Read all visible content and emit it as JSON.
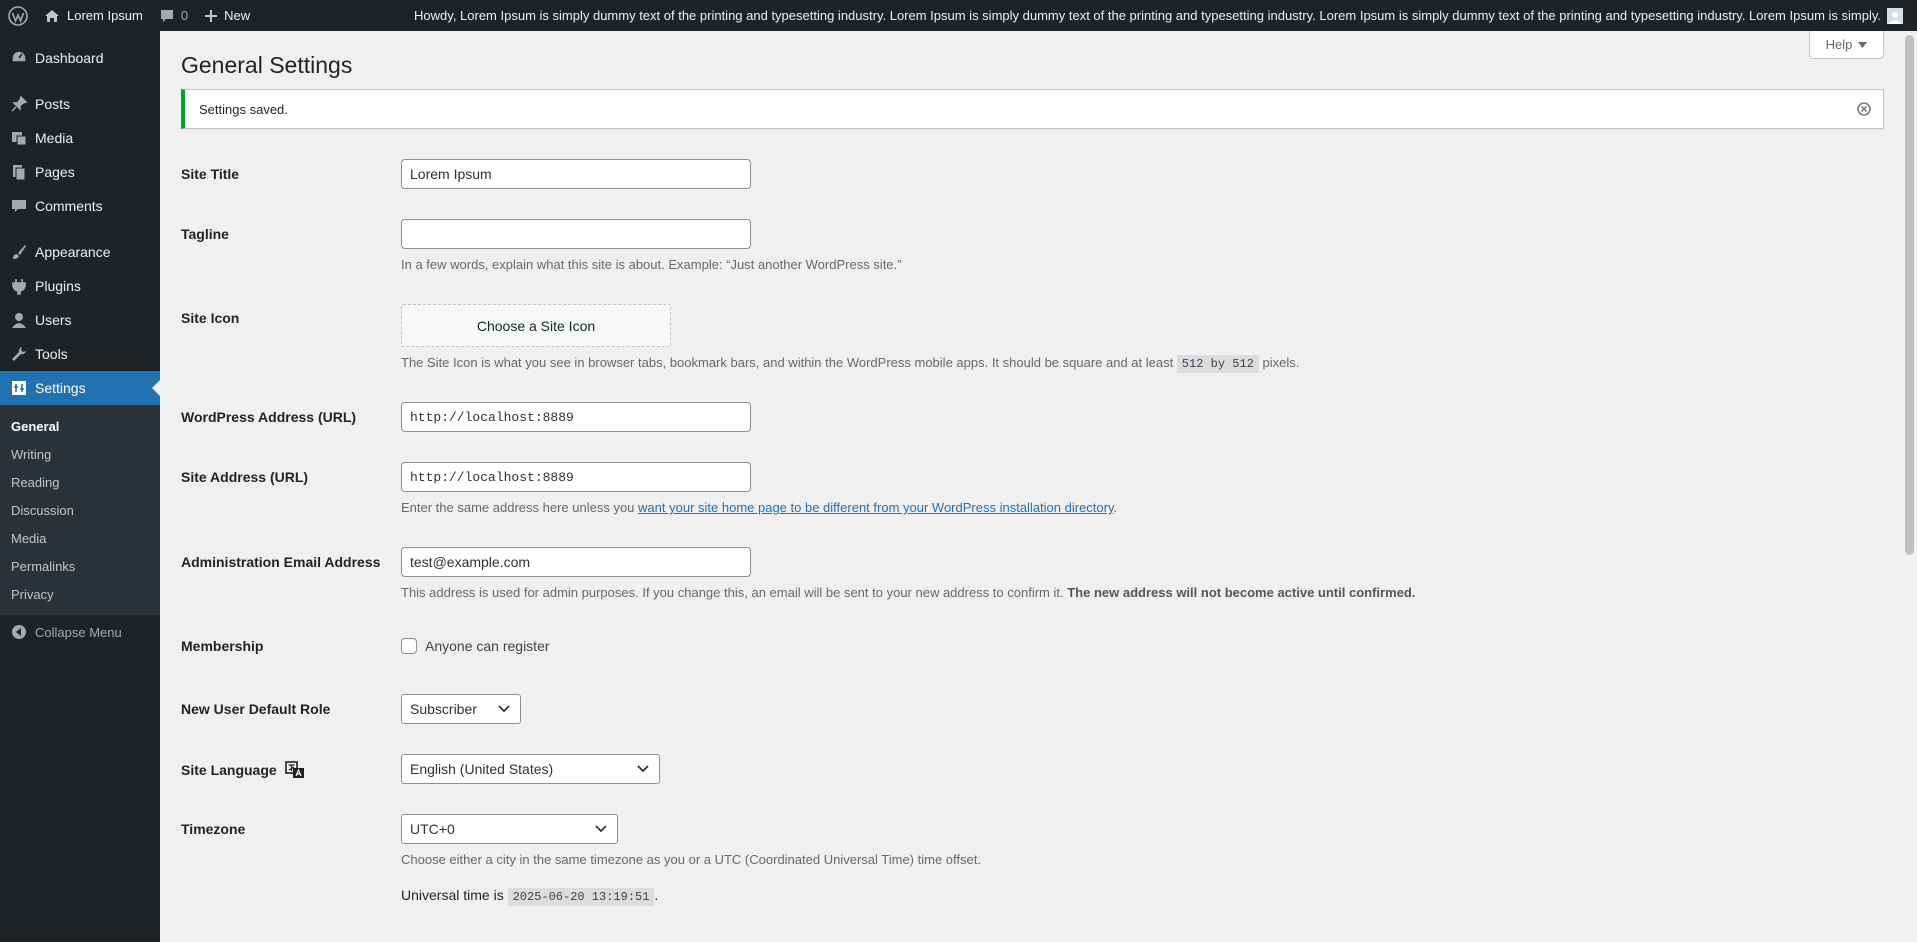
{
  "admin_bar": {
    "site_name": "Lorem Ipsum",
    "comments_count": "0",
    "new_label": "New",
    "howdy_text": "Howdy, Lorem Ipsum is simply dummy text of the printing and typesetting industry. Lorem Ipsum is simply dummy text of the printing and typesetting industry. Lorem Ipsum is simply dummy text of the printing and typesetting industry. Lorem Ipsum is simply."
  },
  "sidebar": {
    "items": [
      {
        "label": "Dashboard",
        "icon": "dashboard-icon"
      },
      {
        "label": "Posts",
        "icon": "pin-icon"
      },
      {
        "label": "Media",
        "icon": "media-icon"
      },
      {
        "label": "Pages",
        "icon": "pages-icon"
      },
      {
        "label": "Comments",
        "icon": "comment-icon"
      },
      {
        "label": "Appearance",
        "icon": "brush-icon"
      },
      {
        "label": "Plugins",
        "icon": "plugin-icon"
      },
      {
        "label": "Users",
        "icon": "user-icon"
      },
      {
        "label": "Tools",
        "icon": "wrench-icon"
      },
      {
        "label": "Settings",
        "icon": "settings-icon"
      }
    ],
    "submenu": [
      "General",
      "Writing",
      "Reading",
      "Discussion",
      "Media",
      "Permalinks",
      "Privacy"
    ],
    "collapse_label": "Collapse Menu"
  },
  "page": {
    "title": "General Settings",
    "help_label": "Help",
    "notice": "Settings saved."
  },
  "form": {
    "site_title": {
      "label": "Site Title",
      "value": "Lorem Ipsum"
    },
    "tagline": {
      "label": "Tagline",
      "value": "",
      "description": "In a few words, explain what this site is about. Example: “Just another WordPress site.”"
    },
    "site_icon": {
      "label": "Site Icon",
      "button": "Choose a Site Icon",
      "description_before": "The Site Icon is what you see in browser tabs, bookmark bars, and within the WordPress mobile apps. It should be square and at least",
      "description_code": "512 by 512",
      "description_after": "pixels."
    },
    "wp_address": {
      "label": "WordPress Address (URL)",
      "value": "http://localhost:8889"
    },
    "site_address": {
      "label": "Site Address (URL)",
      "value": "http://localhost:8889",
      "description_before": "Enter the same address here unless you",
      "description_link": "want your site home page to be different from your WordPress installation directory",
      "description_after": "."
    },
    "admin_email": {
      "label": "Administration Email Address",
      "value": "test@example.com",
      "description": "This address is used for admin purposes. If you change this, an email will be sent to your new address to confirm it.",
      "description_strong": "The new address will not become active until confirmed."
    },
    "membership": {
      "label": "Membership",
      "checkbox_label": "Anyone can register"
    },
    "default_role": {
      "label": "New User Default Role",
      "value": "Subscriber"
    },
    "site_language": {
      "label": "Site Language",
      "value": "English (United States)"
    },
    "timezone": {
      "label": "Timezone",
      "value": "UTC+0",
      "description": "Choose either a city in the same timezone as you or a UTC (Coordinated Universal Time) time offset.",
      "universal_label": "Universal time is",
      "universal_time": "2025-06-20 13:19:51",
      "universal_after": "."
    }
  },
  "colors": {
    "accent": "#2271b1",
    "adminbar": "#1d2327",
    "notice_success": "#00a32a"
  }
}
